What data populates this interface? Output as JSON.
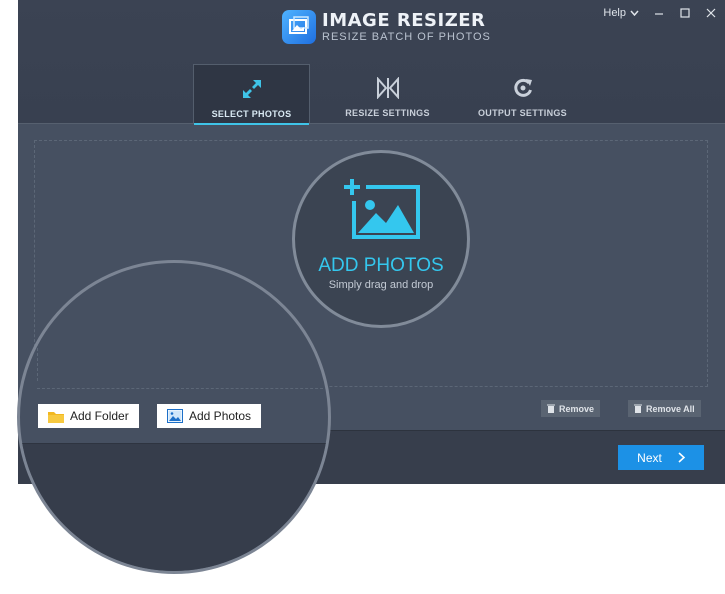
{
  "app": {
    "title": "IMAGE RESIZER",
    "subtitle": "RESIZE BATCH OF PHOTOS",
    "help_label": "Help"
  },
  "tabs": [
    {
      "label": "SELECT PHOTOS",
      "icon": "expand-arrows-icon",
      "active": true
    },
    {
      "label": "RESIZE SETTINGS",
      "icon": "resize-settings-icon",
      "active": false
    },
    {
      "label": "OUTPUT SETTINGS",
      "icon": "output-settings-icon",
      "active": false
    }
  ],
  "dropzone": {
    "title": "ADD PHOTOS",
    "subtitle": "Simply drag and drop"
  },
  "actions": {
    "remove_label": "Remove",
    "remove_all_label": "Remove All",
    "add_folder_label": "Add Folder",
    "add_photos_label": "Add Photos",
    "next_label": "Next"
  },
  "colors": {
    "accent": "#34c7ee",
    "primary_button": "#1c91e6",
    "background": "#465061",
    "header": "#3b4353"
  }
}
